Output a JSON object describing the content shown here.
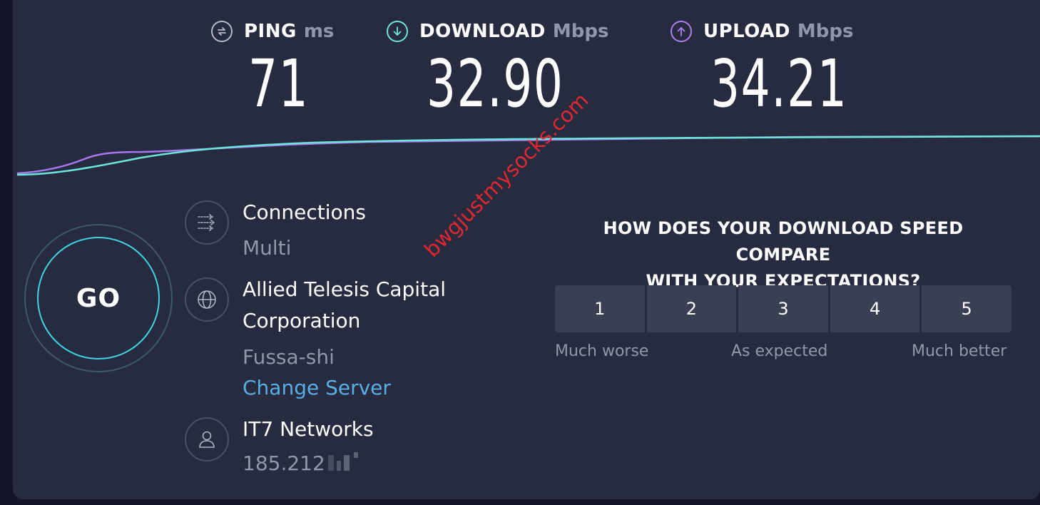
{
  "metrics": {
    "ping": {
      "name": "PING",
      "unit": "ms",
      "value": "71",
      "color": "#b6b9c8",
      "icon": "ping-icon"
    },
    "download": {
      "name": "DOWNLOAD",
      "unit": "Mbps",
      "value": "32.90",
      "color": "#6ae6da",
      "icon": "download-arrow-icon"
    },
    "upload": {
      "name": "UPLOAD",
      "unit": "Mbps",
      "value": "34.21",
      "color": "#b07ff0",
      "icon": "upload-arrow-icon"
    }
  },
  "go_label": "GO",
  "connections": {
    "label": "Connections",
    "value": "Multi",
    "icon": "connections-icon"
  },
  "server": {
    "name_line1": "Allied Telesis Capital",
    "name_line2": "Corporation",
    "location": "Fussa-shi",
    "change_label": "Change Server",
    "icon": "globe-icon"
  },
  "provider": {
    "name": "IT7 Networks",
    "ip": "185.212",
    "icon": "user-icon"
  },
  "survey": {
    "question_line1": "HOW DOES YOUR DOWNLOAD SPEED COMPARE",
    "question_line2": "WITH YOUR EXPECTATIONS?",
    "options": [
      "1",
      "2",
      "3",
      "4",
      "5"
    ],
    "label_low": "Much worse",
    "label_mid": "As expected",
    "label_high": "Much better"
  },
  "watermark": "bwgjustmysocks.com",
  "colors": {
    "background": "#272b3f",
    "download_line": "#6ae6da",
    "upload_line": "#a878ee",
    "link": "#5aaee6"
  }
}
